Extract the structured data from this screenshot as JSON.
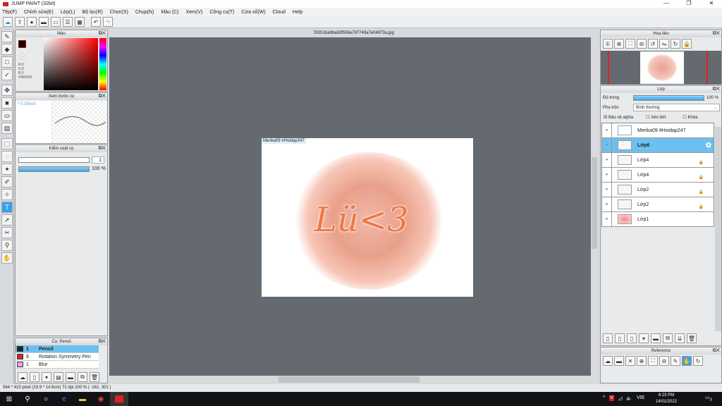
{
  "window": {
    "title": "JUMP PAINT (32bit)",
    "controls": [
      "—",
      "❐",
      "✕"
    ]
  },
  "menu": [
    "Tệp(F)",
    "Chỉnh sửa(E)",
    "Lớp(L)",
    "Bộ lọc(R)",
    "Chọn(S)",
    "Chụp(N)",
    "Màu (C)",
    "Xem(V)",
    "Công cụ(T)",
    "Cửa sổ(W)",
    "Cloud",
    "Help"
  ],
  "toolbar_icons": [
    "cloud-icon",
    "share-icon",
    "comment-icon",
    "message-icon",
    "page-icon",
    "list-icon",
    "grid-icon",
    "undo-icon",
    "redo-icon"
  ],
  "color_panel": {
    "title": "Màu",
    "r": "R:0",
    "g": "G:0",
    "b": "B:0",
    "hex": "#000000",
    "fg": "#000000"
  },
  "brush_preview": {
    "title": "Xem trước cọ",
    "size": "* 0.35mm"
  },
  "brush_control": {
    "title": "Kiểm soát cọ",
    "size_value": "1",
    "opacity": "100 %",
    "opacity_pct": 100
  },
  "brush_list": {
    "title": "Cọ: Pencil",
    "items": [
      {
        "num": "1",
        "name": "Pencil",
        "color": "#1a2530",
        "selected": true
      },
      {
        "num": "8",
        "name": "Rotation Symmetry Pen",
        "color": "#e02020"
      },
      {
        "num": "1",
        "name": "Blur",
        "color": "#f4a0f0"
      }
    ]
  },
  "document": {
    "tab": "78351ba8ba63f556e787749a7e04973a.jpg",
    "text_layer": "Merika09 #Hoidap247",
    "artwork_text": "Lü<3"
  },
  "navigator": {
    "title": "Hoa tiêu"
  },
  "layers": {
    "title": "Lớp",
    "opacity_label": "Độ trong",
    "opacity": "100 %",
    "opacity_pct": 100,
    "blend_label": "Pha trộn",
    "blend": "Bình thường",
    "protect_alpha": "Bảo vệ alpha",
    "clip": "Xén bớt",
    "lock": "Khóa",
    "items": [
      {
        "name": "Merika09 #Hoidap247",
        "selected": false,
        "locked": false
      },
      {
        "name": "Lớp6",
        "selected": true,
        "locked": false
      },
      {
        "name": "Lớp4",
        "locked": true
      },
      {
        "name": "Lớp4",
        "locked": true
      },
      {
        "name": "Lớp2",
        "locked": true
      },
      {
        "name": "Lớp2",
        "locked": true
      },
      {
        "name": "Lớp1",
        "locked": false
      }
    ]
  },
  "reference": {
    "title": "Reference"
  },
  "status": "564 * 423 pixel   (19.9 * 14.9cm)   72 dpi   100 %   ( -161, 301 )",
  "taskbar": {
    "time": "6:23 PM",
    "date": "14/01/2022",
    "lang": "VIE",
    "notifications": "3"
  }
}
